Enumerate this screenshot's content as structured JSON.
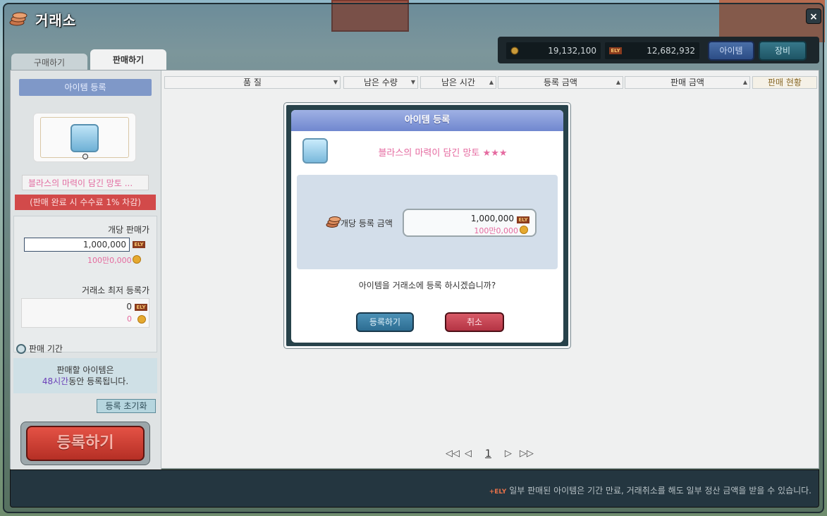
{
  "window": {
    "title": "거래소",
    "close_label": "×"
  },
  "currency": {
    "meso": "19,132,100",
    "maple_points": "12,682,932",
    "item_button": "아이템",
    "equip_button": "장비"
  },
  "tabs": {
    "buy": "구매하기",
    "sell": "판매하기"
  },
  "sidebar": {
    "header": "아이템 등록",
    "item_name": "블라스의 마력이 담긴 망토 ...",
    "fee_note": "(판매 완료 시 수수료 1% 차감)",
    "unit_price_label": "개당 판매가",
    "unit_price_value": "1,000,000",
    "unit_price_kr": "100만0,000",
    "lowest_label": "거래소 최저 등록가",
    "lowest_value": "0",
    "lowest_coin": "0",
    "period_label": "판매 기간",
    "period_line1": "판매할 아이템은",
    "period_hours": "48시간",
    "period_line2": "동안 등록됩니다.",
    "reset_button": "등록 초기화",
    "register_button": "등록하기",
    "ely_tag": "ELY"
  },
  "table": {
    "columns": [
      "품 질",
      "남은 수량",
      "남은 시간",
      "등록 금액",
      "판매 금액"
    ],
    "status_column": "판매 현황"
  },
  "pager": {
    "current": "1"
  },
  "footer": {
    "tag": "+ELY",
    "notice": "일부 판매된 아이템은 기간 만료, 거래취소를 해도 일부 정산 금액을 받을 수 있습니다."
  },
  "modal": {
    "title": "아이템 등록",
    "item_name": "블라스의 마력이 담긴 망토 ★★★",
    "price_label": "개당 등록 금액",
    "price_value": "1,000,000",
    "price_kr": "100만0,000",
    "question": "아이템을 거래소에 등록 하시겠습니까?",
    "ok_button": "등록하기",
    "cancel_button": "취소"
  },
  "colors": {
    "accent_blue": "#7087cf",
    "danger_red": "#b43444",
    "meso_pink": "#e56a9e"
  }
}
